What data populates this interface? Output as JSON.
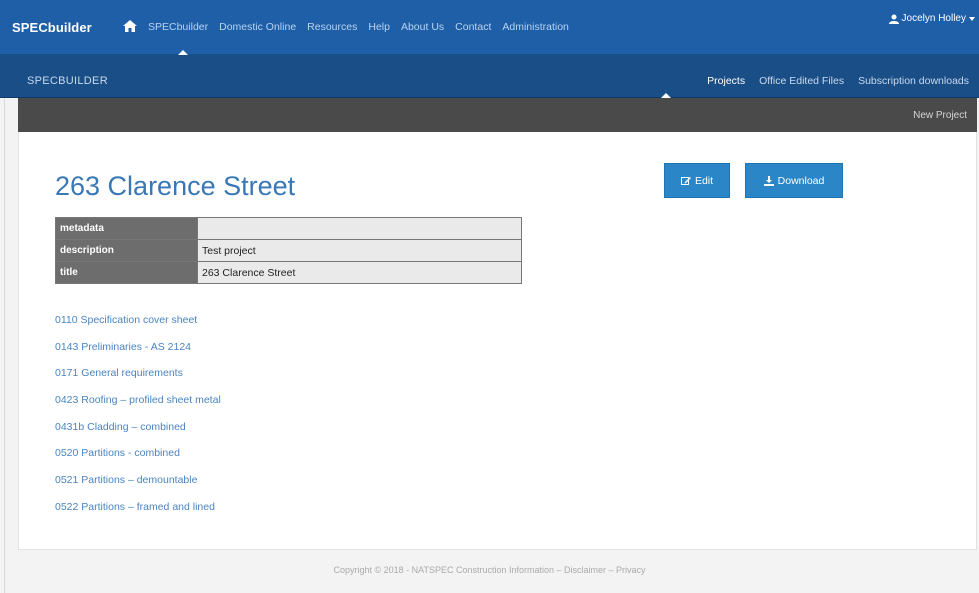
{
  "topbar": {
    "brand": "SPECbuilder",
    "nav": [
      "SPECbuilder",
      "Domestic Online",
      "Resources",
      "Help",
      "About Us",
      "Contact",
      "Administration"
    ],
    "user": "Jocelyn Holley"
  },
  "subbar": {
    "title": "SPECBUILDER",
    "nav": [
      "Projects",
      "Office Edited Files",
      "Subscription downloads"
    ]
  },
  "actionbar": {
    "new_project": "New Project"
  },
  "project": {
    "title": "263 Clarence Street",
    "edit_label": "Edit",
    "download_label": "Download"
  },
  "metadata": [
    {
      "key": "metadata",
      "value": ""
    },
    {
      "key": "description",
      "value": "Test project"
    },
    {
      "key": "title",
      "value": "263 Clarence Street"
    }
  ],
  "documents": [
    "0110 Specification cover sheet",
    "0143 Preliminaries - AS 2124",
    "0171 General requirements",
    "0423 Roofing – profiled sheet metal",
    "0431b Cladding – combined",
    "0520 Partitions - combined",
    "0521 Partitions – demountable",
    "0522 Partitions – framed and lined"
  ],
  "footer": "Copyright © 2018 - NATSPEC Construction Information – Disclaimer – Privacy",
  "colors": {
    "topbar": "#1e5fa8",
    "subbar": "#1a4e87",
    "actionbar": "#4a4a4a",
    "accent": "#2a86c6",
    "link": "#4a84c0"
  }
}
